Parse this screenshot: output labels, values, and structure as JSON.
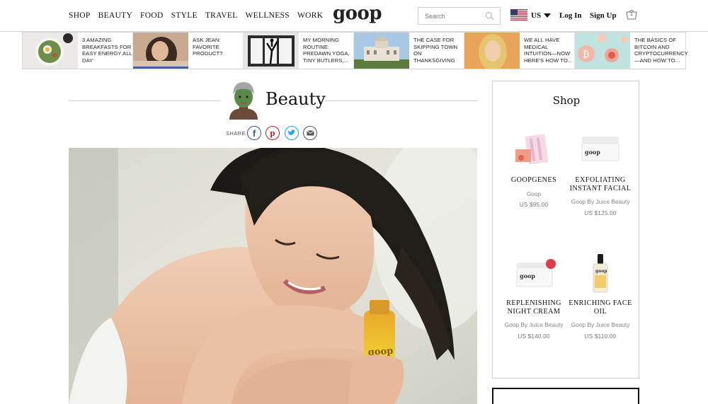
{
  "nav": [
    "SHOP",
    "BEAUTY",
    "FOOD",
    "STYLE",
    "TRAVEL",
    "WELLNESS",
    "WORK"
  ],
  "logo": "goop",
  "search": {
    "placeholder": "Search",
    "icon": "search-icon"
  },
  "account": {
    "country": "US",
    "login": "Log In",
    "signup": "Sign Up",
    "cart_count": "1",
    "flag": "us-flag-icon"
  },
  "promos": [
    {
      "text": "3 AMAZING BREAKFASTS FOR EASY ENERGY ALL DAY",
      "thumb": "breakfast-bowl"
    },
    {
      "text": "ASK JEAN: FAVORITE PRODUCT?",
      "thumb": "woman-portrait"
    },
    {
      "text": "MY MORNING ROUTINE: PREDAWN YOGA, TINY BUTLERS,...",
      "thumb": "yoga-pose"
    },
    {
      "text": "THE CASE FOR SKIPPING TOWN ON THANKSGIVING",
      "thumb": "mansion"
    },
    {
      "text": "WE ALL HAVE MEDICAL INTUITION—NOW HERE'S HOW TO...",
      "thumb": "blonde-woman"
    },
    {
      "text": "THE BASICS OF BITCOIN AND CRYPTOCURRENCY—AND HOW TO...",
      "thumb": "bitcoin-coins"
    }
  ],
  "section": {
    "title": "Beauty",
    "share_label": "SHARE:"
  },
  "share_buttons": [
    "facebook-icon",
    "pinterest-icon",
    "twitter-icon",
    "email-icon"
  ],
  "hero": {
    "image": "woman-with-face-oil-bottle",
    "bottle_brand": "goop"
  },
  "shop": {
    "title": "Shop",
    "products": [
      {
        "name": "GOOPGENES",
        "brand": "Goop",
        "price": "US $95.00"
      },
      {
        "name": "EXFOLIATING INSTANT FACIAL",
        "brand": "Goop By Juice Beauty",
        "price": "US $125.00"
      },
      {
        "name": "REPLENISHING NIGHT CREAM",
        "brand": "Goop By Juice Beauty",
        "price": "US $140.00"
      },
      {
        "name": "ENRICHING FACE OIL",
        "brand": "Goop By Juice Beauty",
        "price": "US $110.00"
      }
    ]
  },
  "colors": {
    "facebook": "#3b5998",
    "pinterest": "#cb2027",
    "twitter": "#1da1f2",
    "email": "#555555",
    "active_promo": "#3a64a8"
  }
}
